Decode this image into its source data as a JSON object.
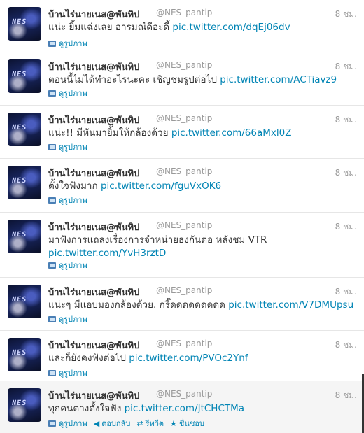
{
  "timeline": {
    "tweets": [
      {
        "name": "บ้านไร่นายเนส@พันทิป",
        "handle": "@NES_pantip",
        "time": "8 ชม.",
        "text": "แน่ะ ยิ้มแฉ่งเลย อารมณ์ดีอ่ะดี้",
        "link": "pic.twitter.com/dqEj06dv",
        "view_photo": "ดูรูปภาพ"
      },
      {
        "name": "บ้านไร่นายเนส@พันทิป",
        "handle": "@NES_pantip",
        "time": "8 ชม.",
        "text": "ตอนนี้ไม่ได้ทำอะไรนะคะ เชิญชมรูปต่อไป",
        "link": "pic.twitter.com/ACTiavz9",
        "view_photo": "ดูรูปภาพ"
      },
      {
        "name": "บ้านไร่นายเนส@พันทิป",
        "handle": "@NES_pantip",
        "time": "8 ชม.",
        "text": "แน่ะ!! มีหันมายิ้มให้กล้องด้วย",
        "link": "pic.twitter.com/66aMxl0Z",
        "view_photo": "ดูรูปภาพ"
      },
      {
        "name": "บ้านไร่นายเนส@พันทิป",
        "handle": "@NES_pantip",
        "time": "8 ชม.",
        "text": "ตั้งใจฟังมาก",
        "link": "pic.twitter.com/fguVxOK6",
        "view_photo": "ดูรูปภาพ"
      },
      {
        "name": "บ้านไร่นายเนส@พันทิป",
        "handle": "@NES_pantip",
        "time": "8 ชม.",
        "text": "มาฟังการแถลงเรื่องการจำหน่ายธงกันต่อ หลังชม VTR",
        "link": "pic.twitter.com/YvH3rztD",
        "view_photo": "ดูรูปภาพ"
      },
      {
        "name": "บ้านไร่นายเนส@พันทิป",
        "handle": "@NES_pantip",
        "time": "8 ชม.",
        "text": "แน่ะๆ มีแอบมองกล้องด้วย. กรี๊ดดดดดดดดด",
        "link": "pic.twitter.com/V7DMUpsu",
        "view_photo": "ดูรูปภาพ"
      },
      {
        "name": "บ้านไร่นายเนส@พันทิป",
        "handle": "@NES_pantip",
        "time": "8 ชม.",
        "text": "และก็ยังคงฟังต่อไป",
        "link": "pic.twitter.com/PVOc2Ynf",
        "view_photo": "ดูรูปภาพ"
      },
      {
        "name": "บ้านไร่นายเนส@พันทิป",
        "handle": "@NES_pantip",
        "time": "8 ชม.",
        "text": "ทุกคนต่างตั้งใจฟัง",
        "link": "pic.twitter.com/JtCHCTMa",
        "view_photo": "ดูรูปภาพ",
        "reply": "ตอบกลับ",
        "retweet": "รีทวีต",
        "favorite": "ชื่นชอบ"
      }
    ]
  },
  "colors": {
    "link": "#0084b4",
    "name": "#333333",
    "meta": "#999999",
    "hover_bg": "#f5f5f5"
  },
  "icons": [
    "photo-icon",
    "reply-icon",
    "retweet-icon",
    "favorite-icon"
  ]
}
